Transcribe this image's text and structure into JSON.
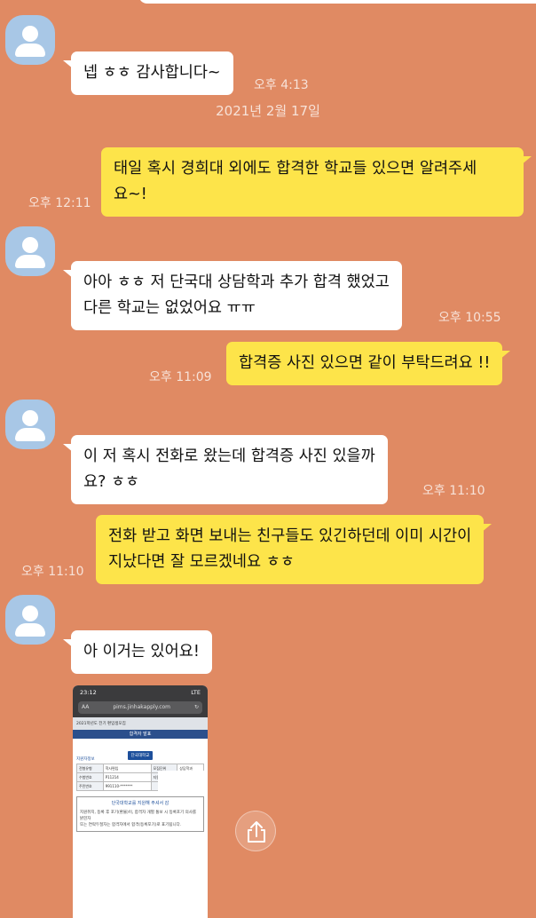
{
  "messages": [
    {
      "text": "넵 ㅎㅎ 감사합니다~",
      "time": "오후 4:13"
    },
    {
      "text": "태일 혹시 경희대 외에도 합격한 학교들 있으면 알려주세\n요~!",
      "time": "오후 12:11"
    },
    {
      "text": "아아 ㅎㅎ 저 단국대 상담학과 추가 합격 했었고\n다른 학교는 없었어요 ㅠㅠ",
      "time": "오후 10:55"
    },
    {
      "text": "합격증 사진 있으면 같이 부탁드려요 !!",
      "time": "오후 11:09"
    },
    {
      "text": "이 저 혹시 전화로 왔는데 합격증 사진 있을까\n요? ㅎㅎ",
      "time": "오후 11:10"
    },
    {
      "text": "전화 받고 화면 보내는 친구들도 있긴하던데 이미 시간이\n지났다면 잘 모르겠네요 ㅎㅎ",
      "time": "오후 11:10"
    },
    {
      "text": "아 이거는 있어요!"
    }
  ],
  "date_separator": "2021년 2월 17일",
  "screenshot": {
    "status_time": "23:12",
    "status_right": "LTE",
    "url_aa": "AA",
    "url": "pims.jinhakapply.com",
    "header_text": "2021학년도 전기 편입생모집",
    "nav_title": "합격자 발표",
    "logo_text": "단국대학교",
    "section_title": "지원자정보",
    "rows": [
      [
        "전형유형",
        "학사편입",
        "모집단위",
        "상담학과"
      ],
      [
        "수험번호",
        "P11214",
        "지원자",
        ""
      ],
      [
        "주민번호",
        "991110-*******",
        "",
        ""
      ]
    ],
    "congrats_title": "단국대학교를 지원해 주셔서 감",
    "notice_lines": [
      "지원취지, 등록 후 포기(환불)이, 합격자 개별 통보 시 등록포기 의사를",
      "밝힌자",
      "또는 연락두절자는 합격자에서 합격(등록포기)로 표기됩니다."
    ],
    "notice_red": "합격(등록포기)"
  },
  "icons": {
    "avatar": "person-avatar-icon",
    "share": "share-icon"
  }
}
